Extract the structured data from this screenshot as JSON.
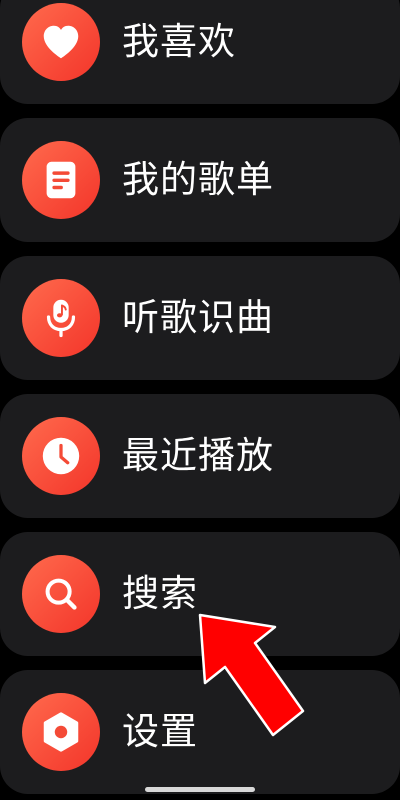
{
  "menu": {
    "items": [
      {
        "label": "我喜欢",
        "icon": "heart-icon"
      },
      {
        "label": "我的歌单",
        "icon": "playlist-document-icon"
      },
      {
        "label": "听歌识曲",
        "icon": "microphone-music-note-icon"
      },
      {
        "label": "最近播放",
        "icon": "clock-icon"
      },
      {
        "label": "搜索",
        "icon": "search-icon"
      },
      {
        "label": "设置",
        "icon": "hexagon-gear-icon"
      }
    ]
  },
  "colors": {
    "background": "#000000",
    "card": "#1c1c1e",
    "icon_gradient_start": "#ff6a4d",
    "icon_gradient_end": "#f3352a",
    "label_text": "#ffffff",
    "arrow": "#ff0000"
  }
}
